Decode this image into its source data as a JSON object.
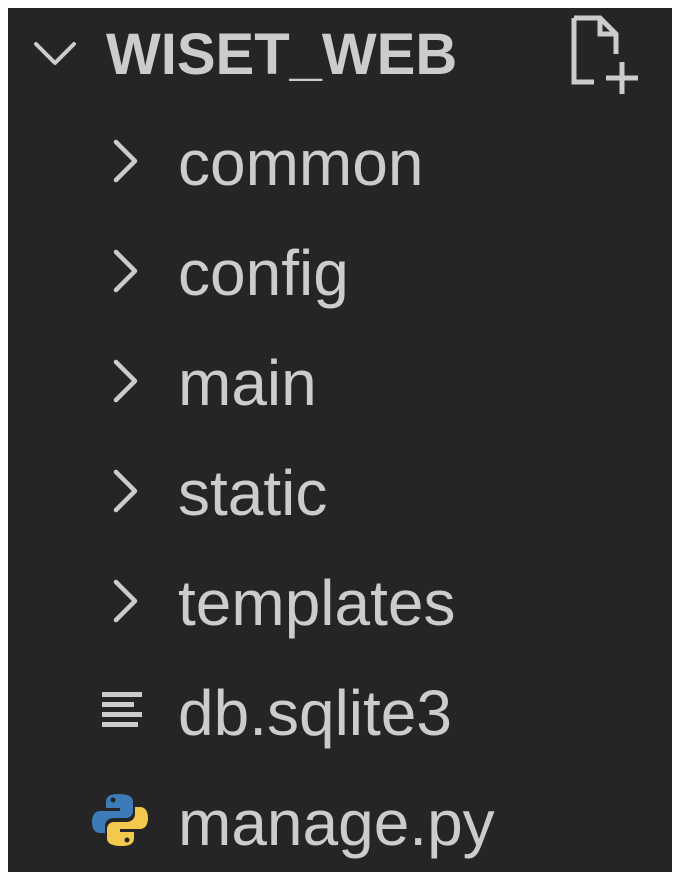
{
  "explorer": {
    "folder_name": "WISET_WEB",
    "folder_icon": "chevron-down-icon",
    "new_file_icon": "new-file-icon",
    "items": [
      {
        "label": "common",
        "type": "folder",
        "icon": "chevron-right-icon"
      },
      {
        "label": "config",
        "type": "folder",
        "icon": "chevron-right-icon"
      },
      {
        "label": "main",
        "type": "folder",
        "icon": "chevron-right-icon"
      },
      {
        "label": "static",
        "type": "folder",
        "icon": "chevron-right-icon"
      },
      {
        "label": "templates",
        "type": "folder",
        "icon": "chevron-right-icon"
      },
      {
        "label": "db.sqlite3",
        "type": "file",
        "icon": "database-file-icon"
      },
      {
        "label": "manage.py",
        "type": "file",
        "icon": "python-icon"
      }
    ]
  },
  "colors": {
    "background": "#252526",
    "text": "#cccccc",
    "python_blue": "#3d7ab8",
    "python_yellow": "#f2c94c"
  }
}
